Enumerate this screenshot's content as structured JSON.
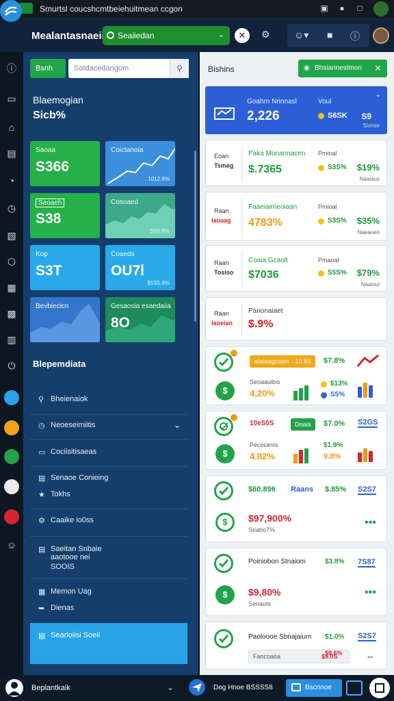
{
  "os_bar": {
    "title": "Smurtsl coucshcmtbeiehuitmean ccgon"
  },
  "app": {
    "name": "Mealantasnaeii"
  },
  "workspace": {
    "label": "Seaiiedan"
  },
  "left_panel": {
    "add_button": "Bsnh",
    "search_placeholder": "Sotdacedangom",
    "title": "Blaemogian",
    "value": "Sicb%",
    "tiles": [
      {
        "label": "Saoaa",
        "value": "S366",
        "sub": ""
      },
      {
        "label": "Coictanoia",
        "value": "",
        "sub": "1012.8%"
      },
      {
        "label": "Saoaeh",
        "value": "S38",
        "sub": ""
      },
      {
        "label": "Cosoaed",
        "value": "",
        "sub": "SS5.8%"
      },
      {
        "label": "Kop",
        "value": "S3T",
        "sub": ""
      },
      {
        "label": "Coaeds",
        "value": "OU7l",
        "sub": "$5S5.8%"
      },
      {
        "label": "Bevbiecicn",
        "value": "",
        "sub": ""
      },
      {
        "label": "Gesaosia esaedaiia",
        "value": "8O",
        "sub": ""
      }
    ],
    "recent_title": "Blepemdiata",
    "recent": [
      {
        "label": "Bheienaiok"
      },
      {
        "label": "Neoeseimiitis"
      },
      {
        "label": "Cociisitisaeas"
      },
      {
        "label": "Senaoe Conieing"
      },
      {
        "label": "Tokhs"
      },
      {
        "label": "Caaike io0ss"
      },
      {
        "label": "Saeitan Snbaie"
      },
      {
        "label": "aaotooe nei"
      },
      {
        "label": "SOOIS"
      },
      {
        "label": "Memon Uag"
      },
      {
        "label": "Dienas"
      },
      {
        "label": "Searioiisi Soeil"
      }
    ]
  },
  "right_panel": {
    "title": "Bishins",
    "action_button": "Bhsiannestmon",
    "hero": {
      "title": "Goahrn Nrinnasl",
      "value": "2,226",
      "label": "Voul",
      "metric": "S6SK",
      "right": "S9",
      "sub": "Slonse"
    },
    "cards": [
      {
        "side_label": "Eoan",
        "side_value": "Tsmeg",
        "title": "Paka Monannacen",
        "value": "$.7365",
        "mlabel": "Pmioal",
        "metric": "S3S%",
        "right": "$19%",
        "sub": "Naaiaus"
      },
      {
        "side_label": "Raan",
        "side_value": "Iaoaag",
        "title": "Faaeiaimeoiaan",
        "value": "4783%",
        "mlabel": "Pmioal",
        "metric": "S3S%",
        "right": "$35%",
        "sub": "Naeaoen"
      },
      {
        "side_label": "Raan",
        "side_value": "Tosiso",
        "title": "Coaia Gcaolt",
        "value": "$7036",
        "mlabel": "Pmaoal",
        "metric": "S5S%",
        "right": "$79%",
        "sub": "Naaioui"
      },
      {
        "side_label": "Raan",
        "side_value": "Iaoeian",
        "title": "Parionaiaet",
        "value": "$.9%",
        "mlabel": "",
        "metric": "",
        "right": "",
        "sub": ""
      }
    ],
    "list_cards": [
      {
        "pill": "aiiaiaagcsion",
        "pill_val": "10.8S",
        "pct": "$7.8%",
        "title": "Seoaauibis",
        "value": "4,20%",
        "a": "$13%",
        "b": "S5%"
      },
      {
        "pill": "10eS0S",
        "pill2": "Doaia",
        "pct": "$7.0%",
        "tag": "S2GS",
        "title": "Pecocenis",
        "value": "4.82%",
        "a": "$1.9%",
        "b": "9.8%"
      },
      {
        "pill": "$60.896",
        "tag2": "Raans",
        "pct": "$.85%",
        "tag": "S2S7",
        "title": "",
        "value": "$97,900%",
        "a": "Seabo7%",
        "b": ""
      },
      {
        "pill": "Poiniobon Stnaiom",
        "pct": "$3.8%",
        "tag": "7S87",
        "title": "",
        "value": "$9,80%",
        "a": "Seoauts",
        "b": ""
      },
      {
        "pill": "Paoloooe Sbnajaium",
        "pct": "$1.0%",
        "tag": "S2S7",
        "title": "Fancoaoa",
        "value": "",
        "a": "$9.6%",
        "b": "$9.0S"
      }
    ]
  },
  "bottom_bar": {
    "label": "Beplantkaik",
    "text": "Dog Hnoe BSSSS8",
    "button": "Bscnnoe"
  },
  "colors": {
    "accent_green": "#22a34a",
    "accent_blue": "#2c5ed8",
    "panel_blue": "#163e6c",
    "danger": "#d8232f",
    "warning": "#f2a818"
  }
}
